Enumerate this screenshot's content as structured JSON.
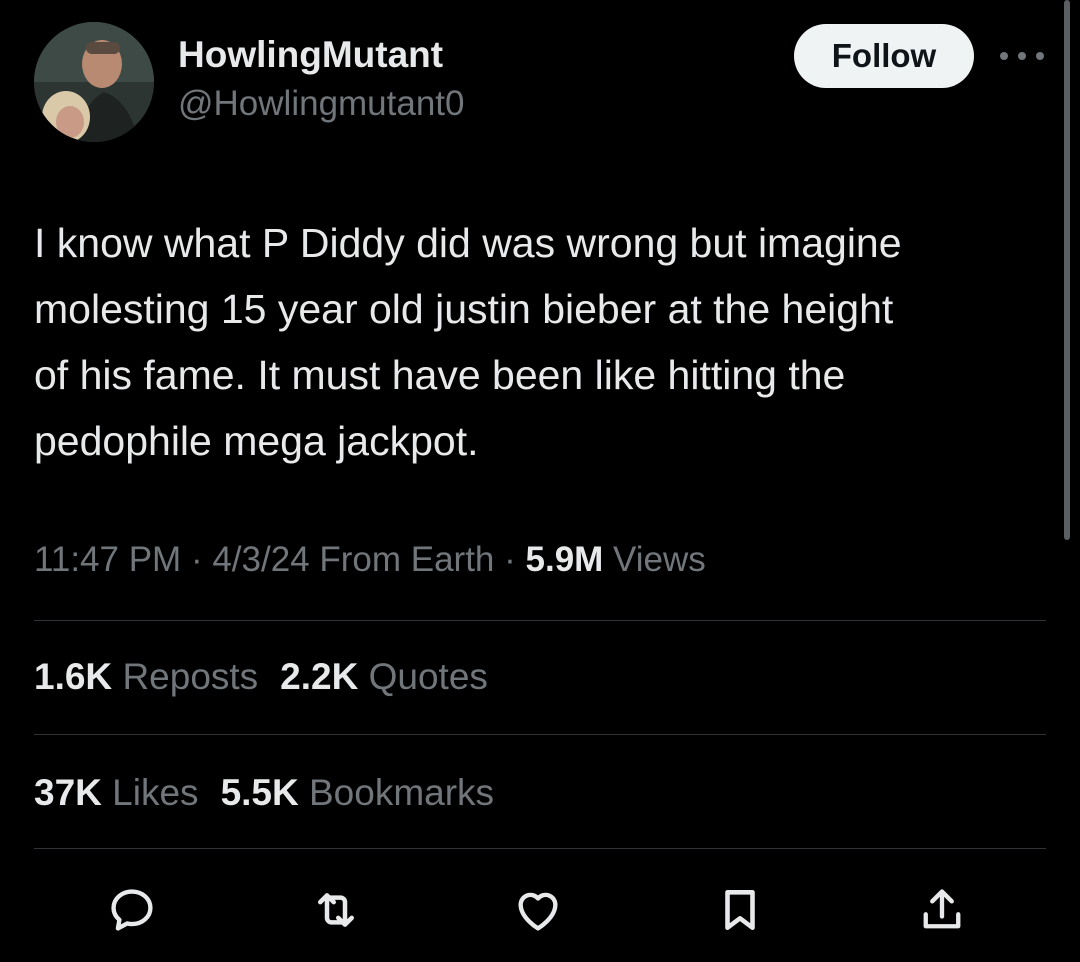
{
  "author": {
    "display_name": "HowlingMutant",
    "handle": "@Howlingmutant0"
  },
  "follow_label": "Follow",
  "tweet_text": "I know what P Diddy did was wrong but imagine\nmolesting 15 year old justin bieber at the height\nof his fame.  It must have been like hitting the\npedophile mega jackpot.",
  "meta": {
    "time": "11:47 PM",
    "sep1": " · ",
    "date": "4/3/24",
    "source": " From Earth",
    "sep2": " · ",
    "views_count": "5.9M",
    "views_label": " Views"
  },
  "stats": {
    "reposts_count": "1.6K",
    "reposts_label": "Reposts",
    "quotes_count": "2.2K",
    "quotes_label": "Quotes",
    "likes_count": "37K",
    "likes_label": "Likes",
    "bookmarks_count": "5.5K",
    "bookmarks_label": "Bookmarks"
  },
  "icons": {
    "avatar": "avatar-photo",
    "more": "more-horizontal-icon",
    "reply": "reply-icon",
    "repost": "repost-icon",
    "like": "heart-icon",
    "bookmark": "bookmark-icon",
    "share": "share-icon"
  },
  "colors": {
    "background": "#000000",
    "text_primary": "#e7e9ea",
    "text_secondary": "#71767b",
    "divider": "#2f3336",
    "follow_bg": "#eff3f4"
  }
}
